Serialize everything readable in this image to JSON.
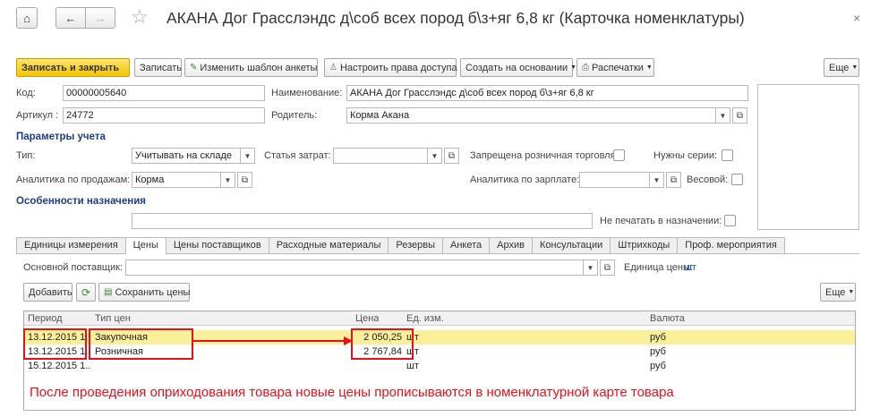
{
  "header": {
    "title": "АКАНА Дог Грасслэндс д\\соб всех пород б\\з+яг 6,8 кг (Карточка номенклатуры)",
    "home_icon": "⌂",
    "back_icon": "←",
    "forward_icon": "→",
    "star_icon": "☆",
    "close_icon": "×"
  },
  "toolbar": {
    "save_close": "Записать и закрыть",
    "save": "Записать",
    "change_template": "Изменить шаблон анкеты",
    "access_rights": "Настроить права доступа",
    "create_based": "Создать на основании",
    "print": "Распечатки",
    "more": "Еще"
  },
  "form": {
    "code_label": "Код:",
    "code_value": "00000005640",
    "name_label": "Наименование:",
    "name_value": "АКАНА Дог Грасслэндс д\\соб всех пород б\\з+яг 6,8 кг",
    "article_label": "Артикул :",
    "article_value": "24772",
    "parent_label": "Родитель:",
    "parent_value": "Корма Акана",
    "accounting_section": "Параметры учета",
    "type_label": "Тип:",
    "type_value": "Учитывать на складе",
    "cost_label": "Статья затрат:",
    "cost_value": "",
    "retail_ban_label": "Запрещена розничная торговля:",
    "series_label": "Нужны серии:",
    "sales_analytics_label": "Аналитика по продажам:",
    "sales_analytics_value": "Корма",
    "salary_analytics_label": "Аналитика по зарплате:",
    "salary_analytics_value": "",
    "weight_label": "Весовой:",
    "purpose_section": "Особенности назначения",
    "purpose_value": "",
    "no_print_label": "Не печатать в назначении:"
  },
  "tabs": [
    {
      "label": "Единицы измерения"
    },
    {
      "label": "Цены"
    },
    {
      "label": "Цены поставщиков"
    },
    {
      "label": "Расходные материалы"
    },
    {
      "label": "Резервы"
    },
    {
      "label": "Анкета"
    },
    {
      "label": "Архив"
    },
    {
      "label": "Консультации"
    },
    {
      "label": "Штрихкоды"
    },
    {
      "label": "Проф. мероприятия"
    }
  ],
  "prices": {
    "supplier_label": "Основной поставщик:",
    "supplier_value": "",
    "unit_label": "Единица цены:",
    "unit_value": "шт",
    "add_button": "Добавить",
    "save_prices_button": "Сохранить цены",
    "more": "Еще",
    "columns": {
      "period": "Период",
      "price_type": "Тип цен",
      "price": "Цена",
      "unit": "Ед. изм.",
      "currency": "Валюта"
    },
    "rows": [
      {
        "period": "13.12.2015 1...",
        "price_type": "Закупочная",
        "price": "2 050,25",
        "unit": "шт",
        "currency": "руб"
      },
      {
        "period": "13.12.2015 1...",
        "price_type": "Розничная",
        "price": "2 767,84",
        "unit": "шт",
        "currency": "руб"
      },
      {
        "period": "15.12.2015 1...",
        "price_type": "",
        "price": "",
        "unit": "шт",
        "currency": "руб"
      }
    ]
  },
  "annotation": "После проведения оприходования товара новые цены прописываются в номенклатурной карте товара",
  "colors": {
    "accent_yellow": "#f2c500",
    "selected_row": "#fcef9a",
    "annotation_red": "#e8101a",
    "section_blue": "#1f3c8a"
  }
}
